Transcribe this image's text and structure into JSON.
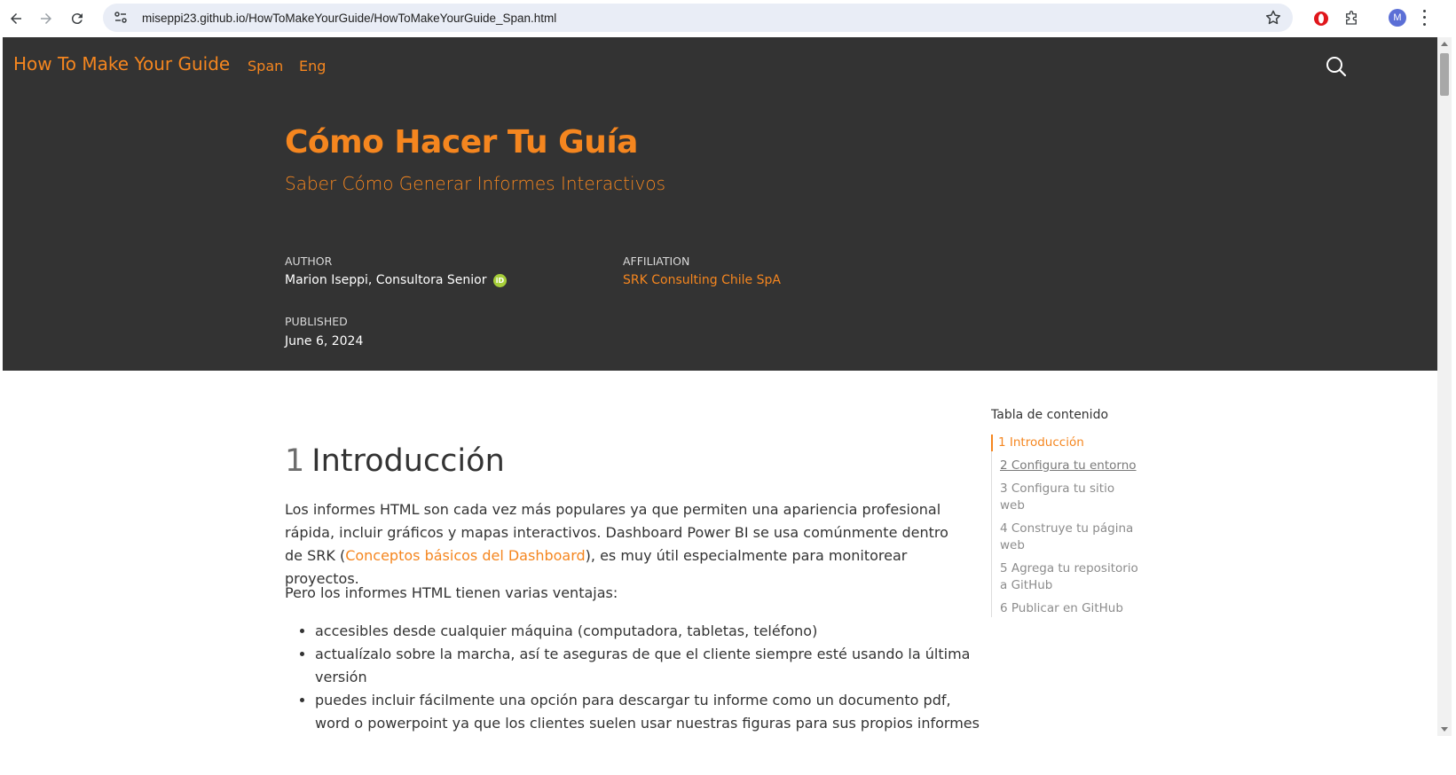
{
  "browser": {
    "url": "miseppi23.github.io/HowToMakeYourGuide/HowToMakeYourGuide_Span.html",
    "avatar_initial": "M"
  },
  "navbar": {
    "brand": "How To Make Your Guide",
    "lang_span": "Span",
    "lang_eng": "Eng"
  },
  "header": {
    "title": "Cómo Hacer Tu Guía",
    "subtitle": "Saber Cómo Generar Informes Interactivos",
    "author_label": "AUTHOR",
    "author_value": "Marion Iseppi, Consultora Senior",
    "orcid_label": "iD",
    "affiliation_label": "AFFILIATION",
    "affiliation_value": "SRK Consulting Chile SpA",
    "published_label": "PUBLISHED",
    "published_value": "June 6, 2024"
  },
  "content": {
    "section_number": "1",
    "section_title": "Introducción",
    "para1_a": "Los informes HTML son cada vez más populares ya que permiten una apariencia profesional rápida, incluir gráficos y mapas interactivos. Dashboard Power BI se usa comúnmente dentro de SRK (",
    "para1_link": "Conceptos básicos del Dashboard",
    "para1_b": "), es muy útil especialmente para monitorear proyectos.",
    "para2": "Pero los informes HTML tienen varias ventajas:",
    "bullets": [
      "accesibles desde cualquier máquina (computadora, tabletas, teléfono)",
      "actualízalo sobre la marcha, así te aseguras de que el cliente siempre esté usando la última versión",
      "puedes incluir fácilmente una opción para descargar tu informe como un documento pdf, word o powerpoint ya que los clientes suelen usar nuestras figuras para sus propios informes internos"
    ]
  },
  "toc": {
    "title": "Tabla de contenido",
    "items": [
      "1 Introducción",
      "2 Configura tu entorno",
      "3 Configura tu sitio web",
      "4 Construye tu página web",
      "5 Agrega tu repositorio a GitHub",
      "6 Publicar en GitHub"
    ]
  },
  "colors": {
    "accent": "#f5861f",
    "banner": "#333333"
  }
}
